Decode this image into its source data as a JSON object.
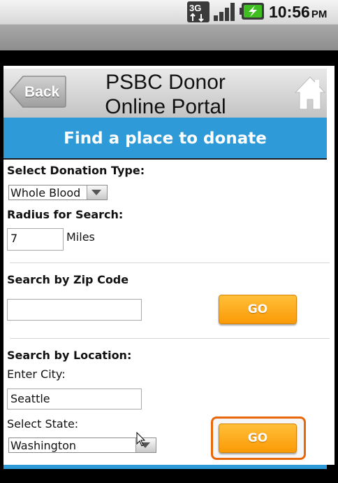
{
  "status_bar": {
    "network": "3G",
    "time": "10:56",
    "ampm": "PM",
    "battery_color": "#3fbf1f"
  },
  "header": {
    "back_label": "Back",
    "title": "PSBC Donor Online Portal",
    "home_icon": "home-icon"
  },
  "banner": {
    "text": "Find a place to donate"
  },
  "donation_type": {
    "label": "Select Donation Type:",
    "selected": "Whole Blood"
  },
  "radius": {
    "label": "Radius for Search:",
    "value": "7",
    "unit": "Miles"
  },
  "zip_search": {
    "label": "Search by Zip Code",
    "value": "",
    "go_label": "GO"
  },
  "location_search": {
    "label": "Search by Location:",
    "city_label": "Enter City:",
    "city_value": "Seattle",
    "state_label": "Select State:",
    "state_selected": "Washington",
    "go_label": "GO"
  },
  "colors": {
    "banner": "#2e9ad8",
    "go_button": "#fb9a06",
    "focus_ring": "#e8670a"
  }
}
